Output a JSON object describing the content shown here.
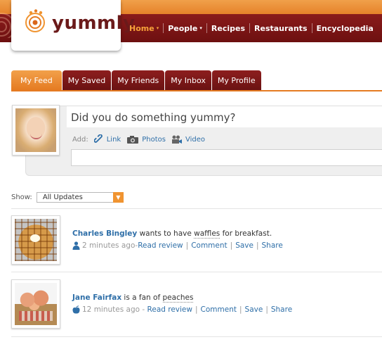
{
  "brand": {
    "name": "yummly"
  },
  "nav": {
    "items": [
      {
        "label": "Home",
        "caret": "▾",
        "active": true
      },
      {
        "label": "People",
        "caret": "▾",
        "active": false
      },
      {
        "label": "Recipes",
        "caret": "",
        "active": false
      },
      {
        "label": "Restaurants",
        "caret": "",
        "active": false
      },
      {
        "label": "Encyclopedia",
        "caret": "",
        "active": false
      }
    ]
  },
  "tabs": [
    {
      "label": "My Feed",
      "active": true
    },
    {
      "label": "My Saved",
      "active": false
    },
    {
      "label": "My Friends",
      "active": false
    },
    {
      "label": "My Inbox",
      "active": false
    },
    {
      "label": "My Profile",
      "active": false
    }
  ],
  "composer": {
    "prompt": "Did you do something yummy?",
    "add_label": "Add:",
    "link_label": "Link",
    "photos_label": "Photos",
    "video_label": "Video"
  },
  "filter": {
    "show_label": "Show:",
    "selected": "All Updates"
  },
  "feed": [
    {
      "name": "Charles Bingley",
      "pre": " wants to have ",
      "subject": "waffles",
      "post": " for breakfast.",
      "time": "2 minutes ago",
      "dash": " -",
      "read_review": "Read review",
      "comment": "Comment",
      "save": "Save",
      "share": "Share",
      "icon": "person-icon"
    },
    {
      "name": "Jane Fairfax",
      "pre": " is a fan of ",
      "subject": "peaches",
      "post": "",
      "time": "12 minutes ago",
      "dash": " - ",
      "read_review": "Read review",
      "comment": "Comment",
      "save": "Save",
      "share": "Share",
      "icon": "apple-icon"
    }
  ],
  "separator": "|",
  "colors": {
    "accent": "#e57b22",
    "brand": "#6d1010",
    "link": "#2f6fa8"
  }
}
